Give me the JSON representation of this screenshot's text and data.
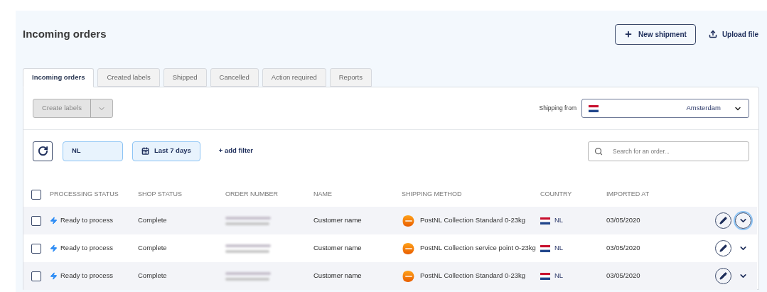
{
  "page_title": "Incoming orders",
  "header_buttons": [
    {
      "kind": "outlined",
      "label": "New shipment"
    },
    {
      "kind": "plain",
      "label": "Upload file"
    }
  ],
  "tabs": [
    {
      "label": "Incoming orders",
      "selected": true
    },
    {
      "label": "Created labels",
      "selected": false
    },
    {
      "label": "Shipped",
      "selected": false
    },
    {
      "label": "Cancelled",
      "selected": false
    },
    {
      "label": "Action required",
      "selected": false
    },
    {
      "label": "Reports",
      "selected": false
    }
  ],
  "create_labels": {
    "label": "Create labels",
    "disabled": true
  },
  "shipping_from": {
    "label": "Shipping from",
    "value": "Amsterdam"
  },
  "filters": [
    {
      "kind": "country",
      "label": "NL"
    },
    {
      "kind": "date",
      "label": "Last 7 days"
    },
    {
      "kind": "add",
      "label": "+ add filter"
    }
  ],
  "search": {
    "placeholder": "Search for an order..."
  },
  "table": {
    "select_all_checked": false,
    "columns": [
      "PROCESSING STATUS",
      "SHOP STATUS",
      "ORDER NUMBER",
      "NAME",
      "SHIPPING METHOD",
      "COUNTRY",
      "IMPORTED AT"
    ],
    "rows": [
      {
        "checked": false,
        "processing_status": "Ready to process",
        "shop_status": "Complete",
        "name": "Customer name",
        "shipping_method": "PostNL Collection Standard 0-23kg",
        "country": "NL",
        "imported_at": "03/05/2020",
        "focused": true
      },
      {
        "checked": false,
        "processing_status": "Ready to process",
        "shop_status": "Complete",
        "name": "Customer name",
        "shipping_method": "PostNL Collection service point 0-23kg",
        "country": "NL",
        "imported_at": "03/05/2020",
        "focused": false
      },
      {
        "checked": false,
        "processing_status": "Ready to process",
        "shop_status": "Complete",
        "name": "Customer name",
        "shipping_method": "PostNL Collection Standard 0-23kg",
        "country": "NL",
        "imported_at": "03/05/2020",
        "focused": false
      }
    ]
  }
}
